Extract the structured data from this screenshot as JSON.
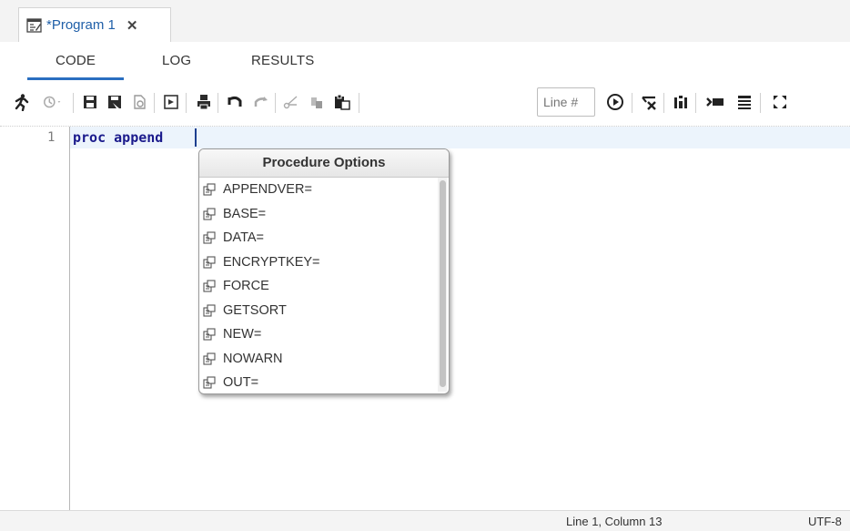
{
  "doc_tab": {
    "label": "*Program 1",
    "close": "✕"
  },
  "subtabs": {
    "code": "CODE",
    "log": "LOG",
    "results": "RESULTS"
  },
  "toolbar": {
    "line_placeholder": "Line #",
    "icons": [
      "run-icon",
      "history-icon",
      "save-icon",
      "save-as-icon",
      "new-icon",
      "export-icon",
      "print-icon",
      "undo-icon",
      "redo-icon",
      "cut-icon",
      "copy-icon",
      "paste-icon",
      "go-to-line-icon",
      "clear-icon",
      "format-icon",
      "add-snippet-icon",
      "outline-icon",
      "maximize-icon"
    ]
  },
  "editor": {
    "line_number": "1",
    "code": "proc append "
  },
  "popup": {
    "title": "Procedure Options",
    "items": [
      "APPENDVER=",
      "BASE=",
      "DATA=",
      "ENCRYPTKEY=",
      "FORCE",
      "GETSORT",
      "NEW=",
      "NOWARN",
      "OUT="
    ]
  },
  "status": {
    "position": "Line 1, Column 13",
    "encoding": "UTF-8"
  },
  "colors": {
    "accent": "#2a6fc0",
    "keyword": "#1a1a8c",
    "current_line": "#ecf4fc"
  }
}
